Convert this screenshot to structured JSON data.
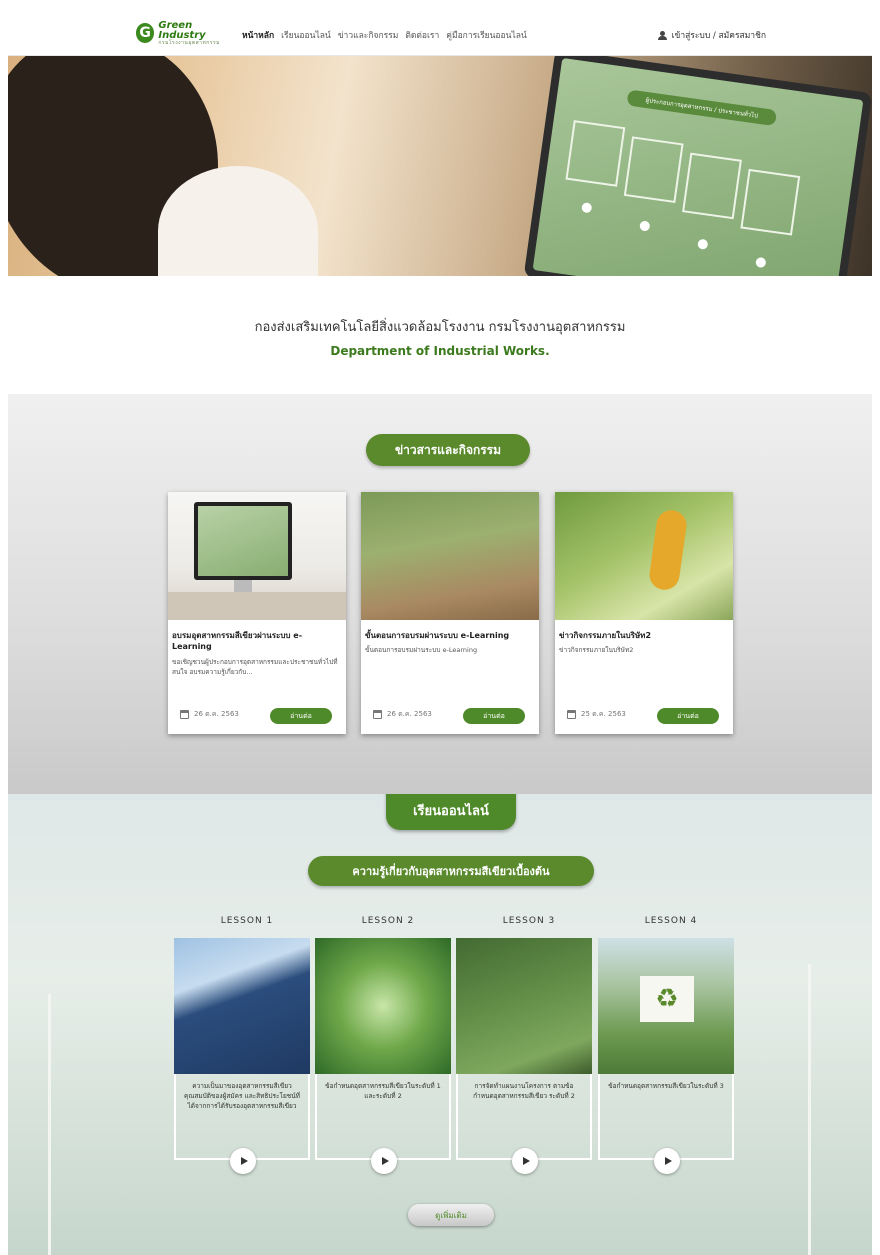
{
  "header": {
    "logo_title": "Green Industry",
    "logo_subtitle": "กรมโรงงานอุตสาหกรรม",
    "nav": [
      "หน้าหลัก",
      "เรียนออนไลน์",
      "ข่าวและกิจกรรม",
      "ติดต่อเรา",
      "คู่มือการเรียนออนไลน์"
    ],
    "login_label": "เข้าสู่ระบบ / สมัครสมาชิก"
  },
  "hero": {
    "screen_banner": "ผู้ประกอบการอุตสาหกรรม / ประชาชนทั่วไป"
  },
  "intro": {
    "title_th": "กองส่งเสริมเทคโนโลยีสิ่งแวดล้อมโรงงาน กรมโรงงานอุตสาหกรรม",
    "title_en": "Department of Industrial Works."
  },
  "news": {
    "section_title": "ข่าวสารและกิจกรรม",
    "cards": [
      {
        "title": "อบรมอุตสาหกรรมสีเขียวผ่านระบบ e-Learning",
        "desc": "ขอเชิญชวนผู้ประกอบการอุตสาหกรรมและประชาชนทั่วไปที่สนใจ อบรมความรู้เกี่ยวกับ...",
        "date": "26 ต.ค. 2563",
        "button": "อ่านต่อ"
      },
      {
        "title": "ขั้นตอนการอบรมผ่านระบบ e-Learning",
        "desc": "ขั้นตอนการอบรมผ่านระบบ e-Learning",
        "date": "26 ต.ค. 2563",
        "button": "อ่านต่อ"
      },
      {
        "title": "ข่าวกิจกรรมภายในบริษัท2",
        "desc": "ข่าวกิจกรรมภายในบริษัท2",
        "date": "25 ต.ค. 2563",
        "button": "อ่านต่อ"
      }
    ]
  },
  "learning": {
    "tab_label": "เรียนออนไลน์",
    "course_title": "ความรู้เกี่ยวกับอุตสาหกรรมสีเขียวเบื้องต้น",
    "lessons": [
      {
        "label": "LESSON 1",
        "text": "ความเป็นมาของอุตสาหกรรมสีเขียว คุณสมบัติของผู้สมัคร และสิทธิประโยชน์ที่ได้จากการได้รับรองอุตสาหกรรมสีเขียว"
      },
      {
        "label": "LESSON 2",
        "text": "ข้อกำหนดอุตสาหกรรมสีเขียวในระดับที่ 1 และระดับที่ 2"
      },
      {
        "label": "LESSON 3",
        "text": "การจัดทำแผนงานโครงการ ตามข้อกำหนดอุตสาหกรรมสีเขียว ระดับที่ 2"
      },
      {
        "label": "LESSON 4",
        "text": "ข้อกำหนดอุตสาหกรรมสีเขียวในระดับที่ 3"
      }
    ],
    "more_button": "ดูเพิ่มเติม"
  },
  "colors": {
    "accent_green": "#4f8a2a",
    "brand_green": "#3c7a1e"
  }
}
